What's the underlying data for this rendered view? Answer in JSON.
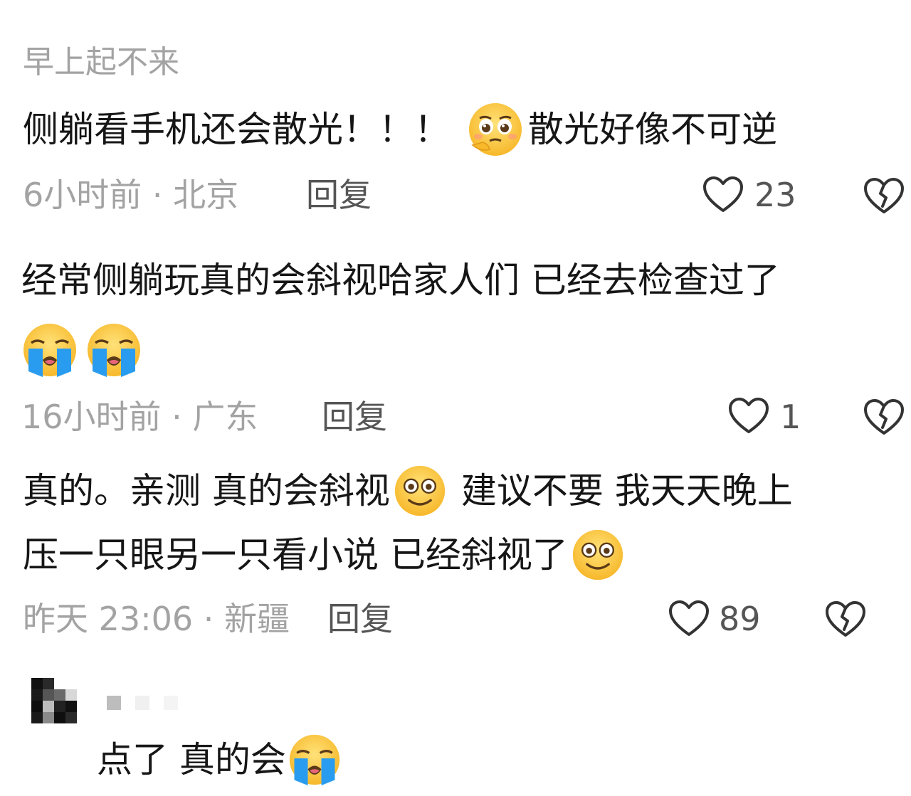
{
  "top_comment": {
    "username": "早上起不来",
    "text_a": "侧躺看手机还会散光！！！",
    "emoji_a": "pleading-face-icon",
    "text_b": "散光好像不可逆",
    "time": "6小时前",
    "location": "北京",
    "reply_label": "回复",
    "likes": "23"
  },
  "reply_1": {
    "line1": "经常侧躺玩真的会斜视哈家人们 已经去检查过了",
    "emojis": [
      "loudly-crying-face-icon",
      "loudly-crying-face-icon"
    ],
    "time": "16小时前",
    "location": "广东",
    "reply_label": "回复",
    "likes": "1"
  },
  "reply_2": {
    "line1_a": "真的。亲测 真的会斜视",
    "line1_emoji": "grinning-face-icon",
    "line1_b": "建议不要 我天天晚上",
    "line2_a": "压一只眼另一只看小说 已经斜视了",
    "line2_emoji": "grinning-face-icon",
    "time": "昨天 23:06",
    "location": "新疆",
    "reply_label": "回复",
    "likes": "89"
  },
  "reply_3": {
    "avatar": "pixelated-avatar",
    "text": "点了 真的会",
    "emoji": "loudly-crying-face-icon"
  },
  "colors": {
    "meta_gray": "#a3a3a3",
    "text_dark": "#161616",
    "emoji_yellow": "#fcc63c",
    "tear_blue": "#2a9cf0"
  }
}
